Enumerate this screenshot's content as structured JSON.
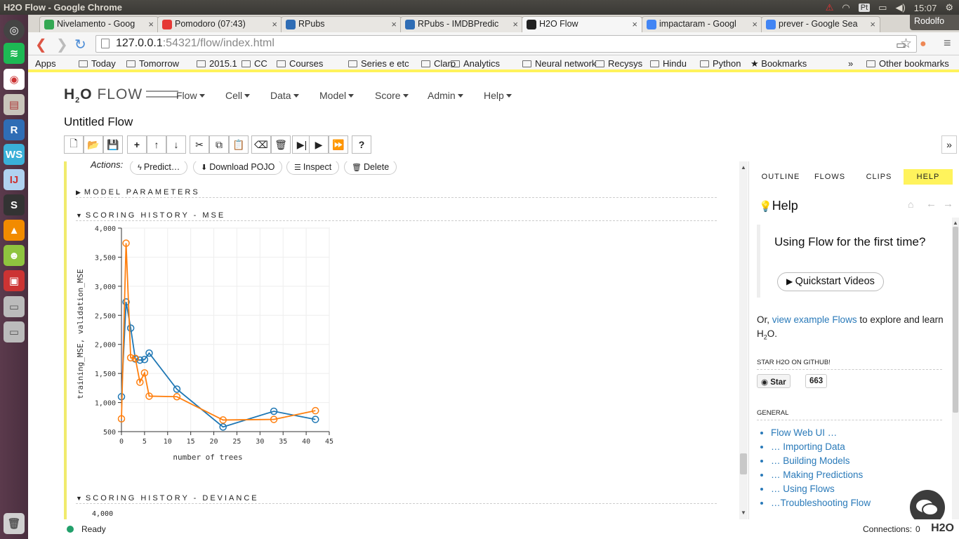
{
  "os": {
    "window_title": "H2O Flow - Google Chrome",
    "kb_layout": "Pt",
    "time": "15:07",
    "user": "Rodolfo"
  },
  "tabs": [
    {
      "label": "Nivelamento - Goog",
      "favicon_color": "#34a853",
      "active": false
    },
    {
      "label": "Pomodoro (07:43)",
      "favicon_color": "#e53935",
      "active": false
    },
    {
      "label": "RPubs",
      "favicon_color": "#2f6db5",
      "active": false
    },
    {
      "label": "RPubs - IMDBPredic",
      "favicon_color": "#2f6db5",
      "active": false
    },
    {
      "label": "H2O Flow",
      "favicon_color": "#222222",
      "active": true
    },
    {
      "label": "impactaram - Googl",
      "favicon_color": "#4285f4",
      "active": false
    },
    {
      "label": "prever - Google Sea",
      "favicon_color": "#4285f4",
      "active": false
    }
  ],
  "address": {
    "host": "127.0.0.1",
    "port_path": ":54321/flow/index.html"
  },
  "bookmarks": [
    "Apps",
    "Today",
    "Tomorrow",
    "2015.1",
    "CC",
    "Courses",
    "Series e etc",
    "Claro",
    "Analytics",
    "Neural network",
    "Recysys",
    "Hindu",
    "Python",
    "Bookmarks",
    "»",
    "Other bookmarks"
  ],
  "flow": {
    "menus": [
      "Flow",
      "Cell",
      "Data",
      "Model",
      "Score",
      "Admin",
      "Help"
    ],
    "title": "Untitled Flow",
    "actions_label": "Actions:",
    "actions": [
      "Predict…",
      "Download POJO",
      "Inspect",
      "Delete"
    ],
    "sections": {
      "params": "MODEL PARAMETERS",
      "mse": "SCORING HISTORY - MSE",
      "deviance": "SCORING HISTORY - DEVIANCE",
      "dev_tick": "4,000"
    }
  },
  "chart_data": {
    "type": "line",
    "title": "",
    "xlabel": "number of trees",
    "ylabel": "training_MSE, validation_MSE",
    "xlim": [
      0,
      45
    ],
    "ylim": [
      500,
      4000
    ],
    "x_ticks": [
      0,
      5,
      10,
      15,
      20,
      25,
      30,
      35,
      40,
      45
    ],
    "y_ticks": [
      500,
      1000,
      1500,
      2000,
      2500,
      3000,
      3500,
      4000
    ],
    "y_tick_labels": [
      "500",
      "1,000",
      "1,500",
      "2,000",
      "2,500",
      "3,000",
      "3,500",
      "4,000"
    ],
    "grid": true,
    "series": [
      {
        "name": "training_MSE",
        "color": "#1f77b4",
        "x": [
          0,
          1,
          2,
          3,
          4,
          5,
          6,
          12,
          22,
          33,
          42
        ],
        "y": [
          1100,
          2730,
          2280,
          1750,
          1730,
          1740,
          1850,
          1230,
          580,
          850,
          710
        ]
      },
      {
        "name": "validation_MSE",
        "color": "#ff7f0e",
        "x": [
          0,
          1,
          2,
          3,
          4,
          5,
          6,
          12,
          22,
          33,
          42
        ],
        "y": [
          720,
          3740,
          1770,
          1760,
          1350,
          1510,
          1110,
          1100,
          700,
          710,
          860
        ]
      }
    ]
  },
  "help": {
    "tabs": [
      "OUTLINE",
      "FLOWS",
      "CLIPS",
      "HELP"
    ],
    "title": "Help",
    "question": "Using Flow for the first time?",
    "quickstart": "Quickstart Videos",
    "or": "Or,",
    "link": "view example Flows",
    "rest": "to explore and learn H",
    "sub": "2",
    "tail": "O.",
    "github_head": "STAR H2O ON GITHUB!",
    "star": "Star",
    "star_count": "663",
    "general_head": "GENERAL",
    "general": [
      "Flow Web UI …",
      "… Importing Data",
      "… Building Models",
      "… Making Predictions",
      "… Using Flows",
      "…Troubleshooting Flow"
    ]
  },
  "status": {
    "text": "Ready",
    "connections_label": "Connections:",
    "connections": "0",
    "brand": "H2O"
  }
}
